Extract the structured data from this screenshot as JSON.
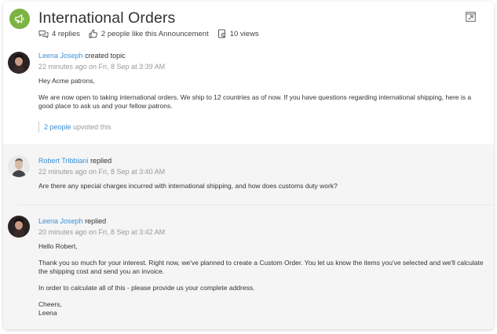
{
  "topic": {
    "title": "International Orders",
    "meta": {
      "replies": "4 replies",
      "likes": "2 people like this Announcement",
      "views": "10 views"
    },
    "icon": "megaphone-icon",
    "accent_color": "#7cb342",
    "link_color": "#3c8fd6"
  },
  "posts": [
    {
      "author": "Leena Joseph",
      "action": "created topic",
      "time": "22 minutes ago on Fri, 8 Sep at 3:39 AM",
      "paragraphs": [
        "Hey Acme patrons,",
        "We are now open to taking international orders. We ship to 12 countries as of now. If you have questions regarding international shipping, here is a good place to ask us and your fellow patrons."
      ],
      "upvote_link": "2 people",
      "upvote_text": "upvoted this"
    },
    {
      "author": "Robert Tribbiani",
      "action": "replied",
      "time": "22 minutes ago on Fri, 8 Sep at 3:40 AM",
      "paragraphs": [
        "Are there any special charges incurred with international shipping, and how does customs duty work?"
      ]
    },
    {
      "author": "Leena Joseph",
      "action": "replied",
      "time": "20 minutes ago on Fri, 8 Sep at 3:42 AM",
      "paragraphs": [
        "Hello Robert,",
        "Thank you so much for your interest. Right now, we've planned to create a Custom Order. You let us know the items you've selected and we'll calculate the shipping cost and send you an invoice.",
        "In order to calculate all of this - please provide us your complete address.",
        "Cheers,",
        "Leena"
      ]
    }
  ]
}
